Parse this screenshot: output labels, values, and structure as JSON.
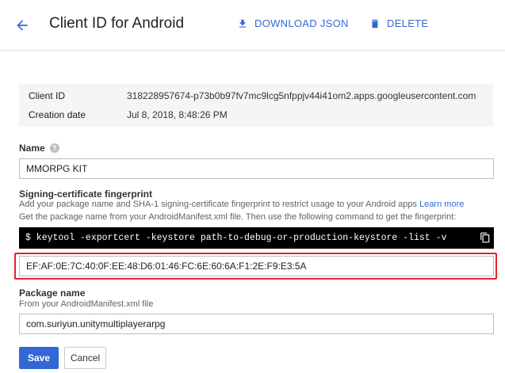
{
  "header": {
    "title": "Client ID for Android",
    "download_label": "DOWNLOAD JSON",
    "delete_label": "DELETE"
  },
  "info": {
    "client_id_label": "Client ID",
    "client_id_value": "318228957674-p73b0b97fv7mc9lcg5nfppjv44i41om2.apps.googleusercontent.com",
    "creation_label": "Creation date",
    "creation_value": "Jul 8, 2018, 8:48:26 PM"
  },
  "name_field": {
    "label": "Name",
    "value": "MMORPG KIT"
  },
  "fingerprint": {
    "label": "Signing-certificate fingerprint",
    "hint1": "Add your package name and SHA-1 signing-certificate fingerprint to restrict usage to your Android apps",
    "learn_more": "Learn more",
    "hint2": "Get the package name from your AndroidManifest.xml file. Then use the following command to get the fingerprint:",
    "command": "$ keytool -exportcert -keystore path-to-debug-or-production-keystore -list -v",
    "value": "EF:AF:0E:7C:40:0F:EE:48:D6:01:46:FC:6E:60:6A:F1:2E:F9:E3:5A"
  },
  "package": {
    "label": "Package name",
    "hint": "From your AndroidManifest.xml file",
    "value": "com.suriyun.unitymultiplayerarpg"
  },
  "actions": {
    "save_label": "Save",
    "cancel_label": "Cancel"
  },
  "colors": {
    "accent": "#3367d6",
    "highlight": "#e0232b"
  }
}
